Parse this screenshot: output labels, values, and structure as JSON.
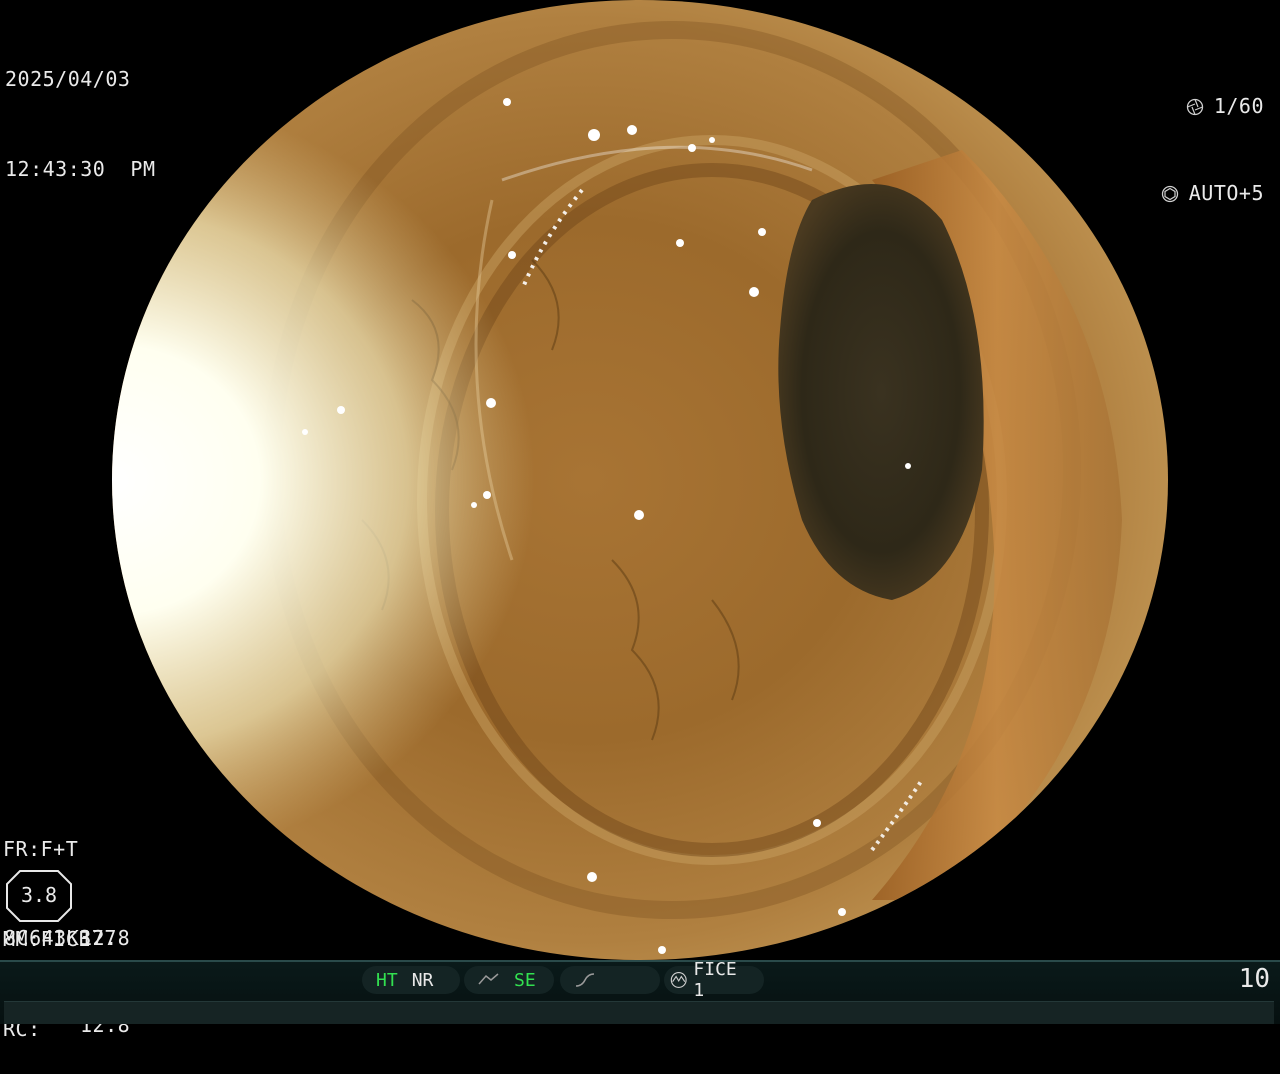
{
  "overlay": {
    "date": "2025/04/03",
    "time": "12:43:30  PM",
    "shutter": "1/60",
    "iris": "AUTO+5",
    "fr": "FR:F+T",
    "mm": "MM:FICE",
    "rc": "RC:",
    "meter_value": "3.8",
    "meter_top": "12.8",
    "meter_bottom": "12.8",
    "serial": "8C643K377"
  },
  "status_bar": {
    "ht": "HT",
    "nr": "NR",
    "se": "SE",
    "fice": "FICE 1",
    "frame": "10",
    "active_color": "#32e050"
  },
  "icons": {
    "shutter": "shutter-icon",
    "iris": "iris-icon",
    "enhance": "enhance-curve-icon",
    "tone": "tone-curve-icon",
    "fice": "fice-mode-icon"
  }
}
